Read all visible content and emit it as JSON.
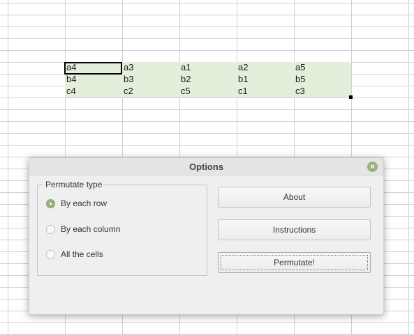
{
  "spreadsheet": {
    "rows": [
      [
        "a4",
        "a3",
        "a1",
        "a2",
        "a5"
      ],
      [
        "b4",
        "b3",
        "b2",
        "b1",
        "b5"
      ],
      [
        "c4",
        "c2",
        "c5",
        "c1",
        "c3"
      ]
    ],
    "selection_color": "#e3eedb"
  },
  "dialog": {
    "title": "Options",
    "close_icon": "close-icon",
    "group_title": "Permutate type",
    "options": [
      {
        "label": "By each row",
        "checked": true
      },
      {
        "label": "By each column",
        "checked": false
      },
      {
        "label": "All the cells",
        "checked": false
      }
    ],
    "buttons": {
      "about": "About",
      "instructions": "Instructions",
      "permutate": "Permutate!"
    },
    "accent_color": "#9bb07a"
  }
}
